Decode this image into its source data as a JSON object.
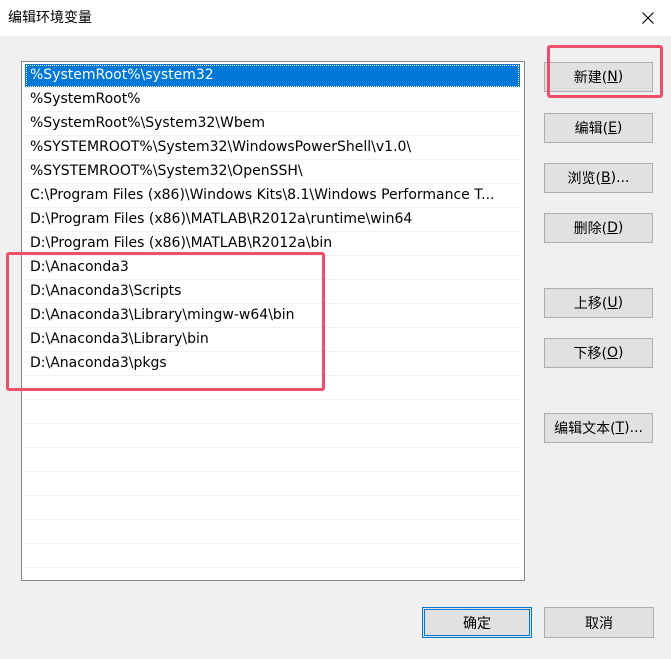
{
  "window": {
    "title": "编辑环境变量"
  },
  "paths": [
    "%SystemRoot%\\system32",
    "%SystemRoot%",
    "%SystemRoot%\\System32\\Wbem",
    "%SYSTEMROOT%\\System32\\WindowsPowerShell\\v1.0\\",
    "%SYSTEMROOT%\\System32\\OpenSSH\\",
    "C:\\Program Files (x86)\\Windows Kits\\8.1\\Windows Performance T...",
    "D:\\Program Files (x86)\\MATLAB\\R2012a\\runtime\\win64",
    "D:\\Program Files (x86)\\MATLAB\\R2012a\\bin",
    "D:\\Anaconda3",
    "D:\\Anaconda3\\Scripts",
    "D:\\Anaconda3\\Library\\mingw-w64\\bin",
    "D:\\Anaconda3\\Library\\bin",
    "D:\\Anaconda3\\pkgs"
  ],
  "buttons": {
    "new": {
      "text": "新建(",
      "key": "N",
      "end": ")"
    },
    "edit": {
      "text": "编辑(",
      "key": "E",
      "end": ")"
    },
    "browse": {
      "text": "浏览(",
      "key": "B",
      "end": ")..."
    },
    "delete": {
      "text": "删除(",
      "key": "D",
      "end": ")"
    },
    "move_up": {
      "text": "上移(",
      "key": "U",
      "end": ")"
    },
    "move_down": {
      "text": "下移(",
      "key": "O",
      "end": ")"
    },
    "edit_text": {
      "text": "编辑文本(",
      "key": "T",
      "end": ")..."
    },
    "ok": "确定",
    "cancel": "取消"
  },
  "colors": {
    "selection": "#0078d7",
    "annotation": "#ef4e6b"
  }
}
